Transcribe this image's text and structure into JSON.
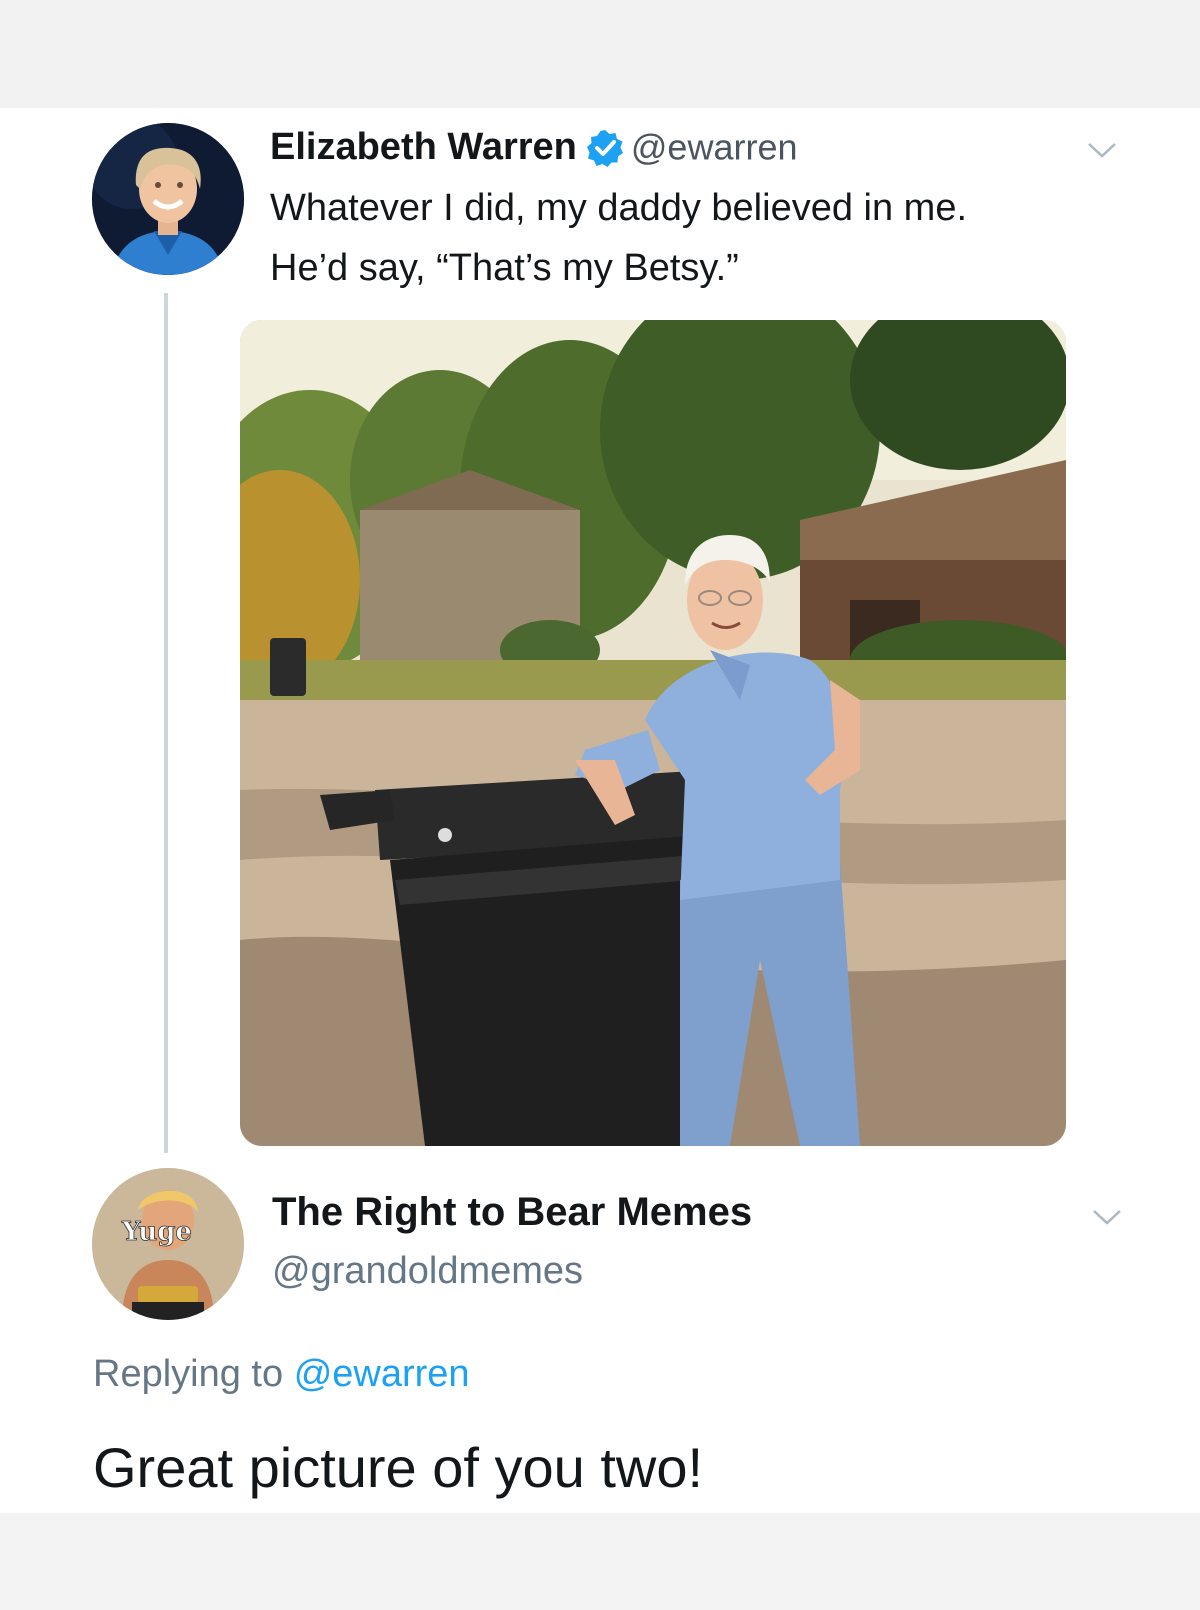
{
  "original_tweet": {
    "author_name": "Elizabeth Warren",
    "handle": "@ewarren",
    "verified": true,
    "text_lines": [
      "Whatever I did, my daddy believed in me.",
      "He’d say, “That’s my Betsy.”"
    ],
    "avatar_icon": "portrait-photo",
    "menu_icon": "chevron-down-icon"
  },
  "reply_tweet": {
    "author_name": "The Right to Bear Memes",
    "handle": "@grandoldmemes",
    "avatar_text": "Yuge",
    "replying_prefix": "Replying to",
    "replying_mention": "@ewarren",
    "text": "Great picture of you two!",
    "menu_icon": "chevron-down-icon"
  },
  "colors": {
    "verified_blue": "#1da1f2",
    "mention_blue": "#1da1f2",
    "secondary_gray": "#657786",
    "thread_line": "#ccd6dd"
  }
}
